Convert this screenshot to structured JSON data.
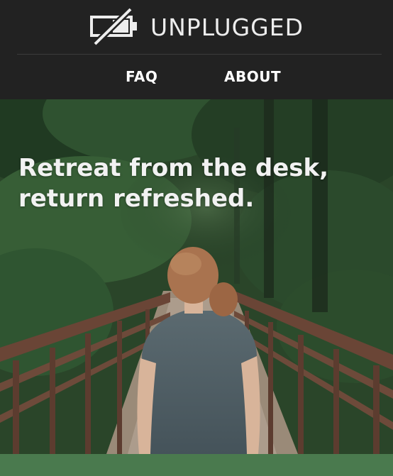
{
  "brand": {
    "name": "UNPLUGGED",
    "logo_icon": "battery-slash-icon"
  },
  "nav": {
    "items": [
      {
        "label": "FAQ"
      },
      {
        "label": "ABOUT"
      }
    ]
  },
  "hero": {
    "headline_line1": "Retreat from the desk,",
    "headline_line2": "return refreshed.",
    "image": "person-on-forest-bridge"
  },
  "colors": {
    "header_bg": "#222222",
    "text": "#ffffff",
    "accent_bar": "#4a7a4e"
  }
}
